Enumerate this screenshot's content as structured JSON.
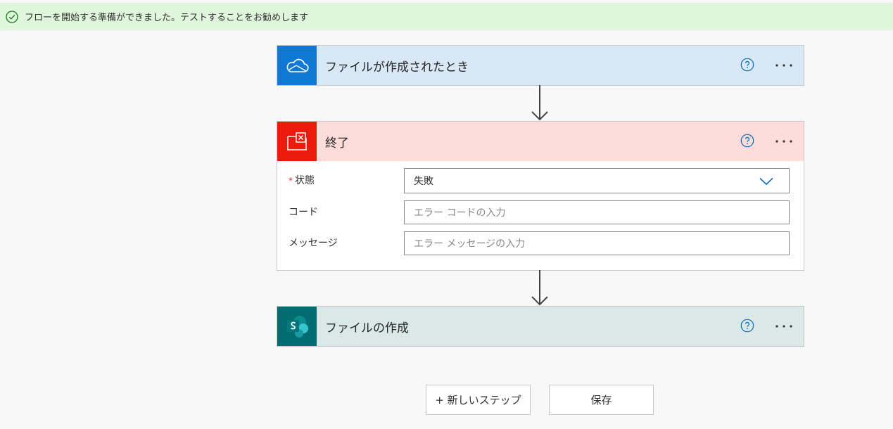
{
  "banner": {
    "icon": "checkmark-circle-icon",
    "message": "フローを開始する準備ができました。テストすることをお勧めします"
  },
  "steps": [
    {
      "title": "ファイルが作成されたとき",
      "icon": "onedrive-cloud-icon",
      "header_color": "#d9e8f6",
      "icon_bg": "#0f78d4"
    },
    {
      "title": "終了",
      "icon": "terminate-icon",
      "header_color": "#fddcda",
      "icon_bg": "#eb1c0c",
      "fields": {
        "status": {
          "label": "状態",
          "required_mark": "*",
          "value": "失敗"
        },
        "code": {
          "label": "コード",
          "placeholder": "エラー コードの入力"
        },
        "message": {
          "label": "メッセージ",
          "placeholder": "エラー メッセージの入力"
        }
      }
    },
    {
      "title": "ファイルの作成",
      "icon": "sharepoint-icon",
      "header_color": "#dae8e7",
      "icon_bg": "#036c70"
    }
  ],
  "footer": {
    "new_step_label": "+ 新しいステップ",
    "save_label": "保存"
  }
}
